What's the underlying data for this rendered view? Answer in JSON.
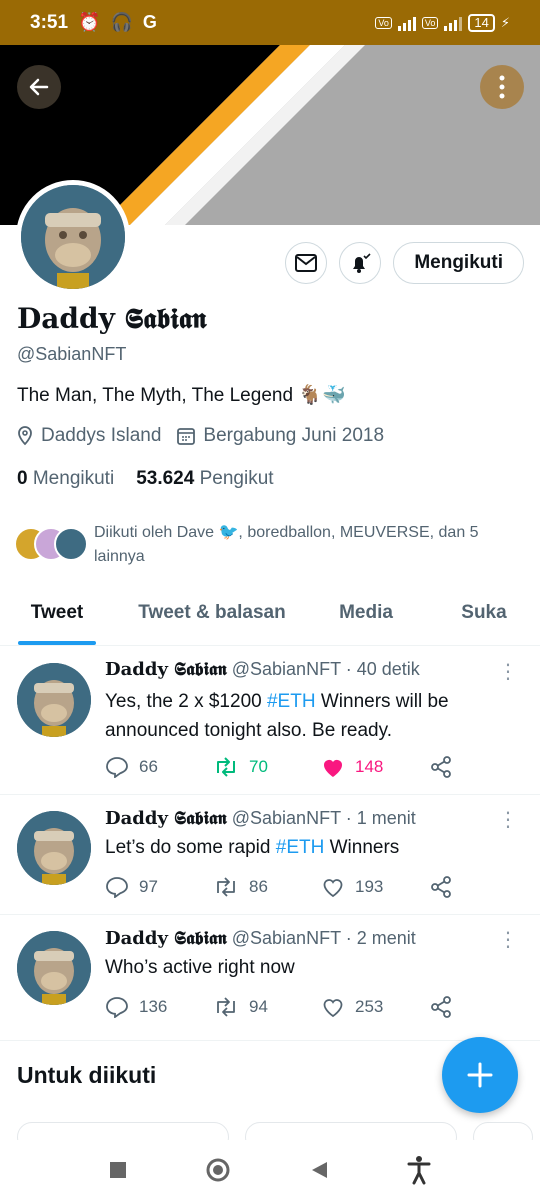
{
  "status_bar": {
    "time": "3:51",
    "battery": "14"
  },
  "profile": {
    "name": "Daddy 𝕾𝖆𝖇𝖎𝖆𝖓",
    "handle": "@SabianNFT",
    "bio": "The Man, The Myth, The Legend 🐐🐳",
    "location": "Daddys Island",
    "joined": "Bergabung Juni 2018",
    "following_count": "0",
    "following_label": "Mengikuti",
    "followers_count": "53.624",
    "followers_label": "Pengikut",
    "follow_button": "Mengikuti",
    "followed_by": "Diikuti oleh Dave 🐦, boredballon, MEUVERSE, dan 5 lainnya"
  },
  "tabs": [
    {
      "label": "Tweet"
    },
    {
      "label": "Tweet & balasan"
    },
    {
      "label": "Media"
    },
    {
      "label": "Suka"
    }
  ],
  "tweets": [
    {
      "name": "Daddy 𝕾𝖆𝖇𝖎𝖆𝖓",
      "handle": "@SabianNFT",
      "time": "· 40 detik",
      "text_pre": "Yes, the 2 x $1200 ",
      "hashtag": "#ETH",
      "text_post": " Winners will be announced tonight also. Be ready.",
      "replies": "66",
      "retweets": "70",
      "likes": "148"
    },
    {
      "name": "Daddy 𝕾𝖆𝖇𝖎𝖆𝖓",
      "handle": "@SabianNFT",
      "time": "· 1 menit",
      "text_pre": "Let’s do some rapid ",
      "hashtag": "#ETH",
      "text_post": " Winners",
      "replies": "97",
      "retweets": "86",
      "likes": "193"
    },
    {
      "name": "Daddy 𝕾𝖆𝖇𝖎𝖆𝖓",
      "handle": "@SabianNFT",
      "time": "· 2 menit",
      "text_pre": "Who’s active right now",
      "hashtag": "",
      "text_post": "",
      "replies": "136",
      "retweets": "94",
      "likes": "253"
    }
  ],
  "who_to_follow": {
    "title": "Untuk diikuti"
  },
  "colors": {
    "accent": "#1d9bf0",
    "retweet": "#00ba7c",
    "like": "#f91880",
    "status_bar": "#9a6a05"
  }
}
